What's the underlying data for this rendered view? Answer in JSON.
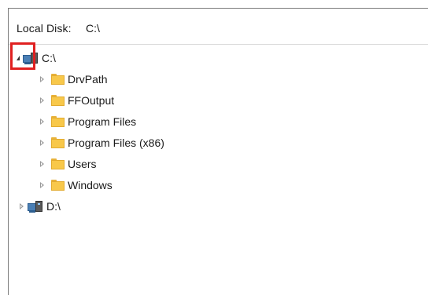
{
  "header": {
    "label": "Local Disk:",
    "value": "C:\\"
  },
  "tree": {
    "root_c": {
      "label": "C:\\",
      "expanded": true,
      "icon": "computer-drive-icon",
      "children": [
        {
          "label": "DrvPath",
          "icon": "folder-icon"
        },
        {
          "label": "FFOutput",
          "icon": "folder-icon"
        },
        {
          "label": "Program Files",
          "icon": "folder-icon"
        },
        {
          "label": "Program Files (x86)",
          "icon": "folder-icon"
        },
        {
          "label": "Users",
          "icon": "folder-icon"
        },
        {
          "label": "Windows",
          "icon": "folder-icon"
        }
      ]
    },
    "root_d": {
      "label": "D:\\",
      "expanded": false,
      "icon": "computer-drive-icon"
    }
  },
  "colors": {
    "highlight": "#e02020",
    "folder": "#f8c84a",
    "drive_screen": "#4a7fb5"
  }
}
